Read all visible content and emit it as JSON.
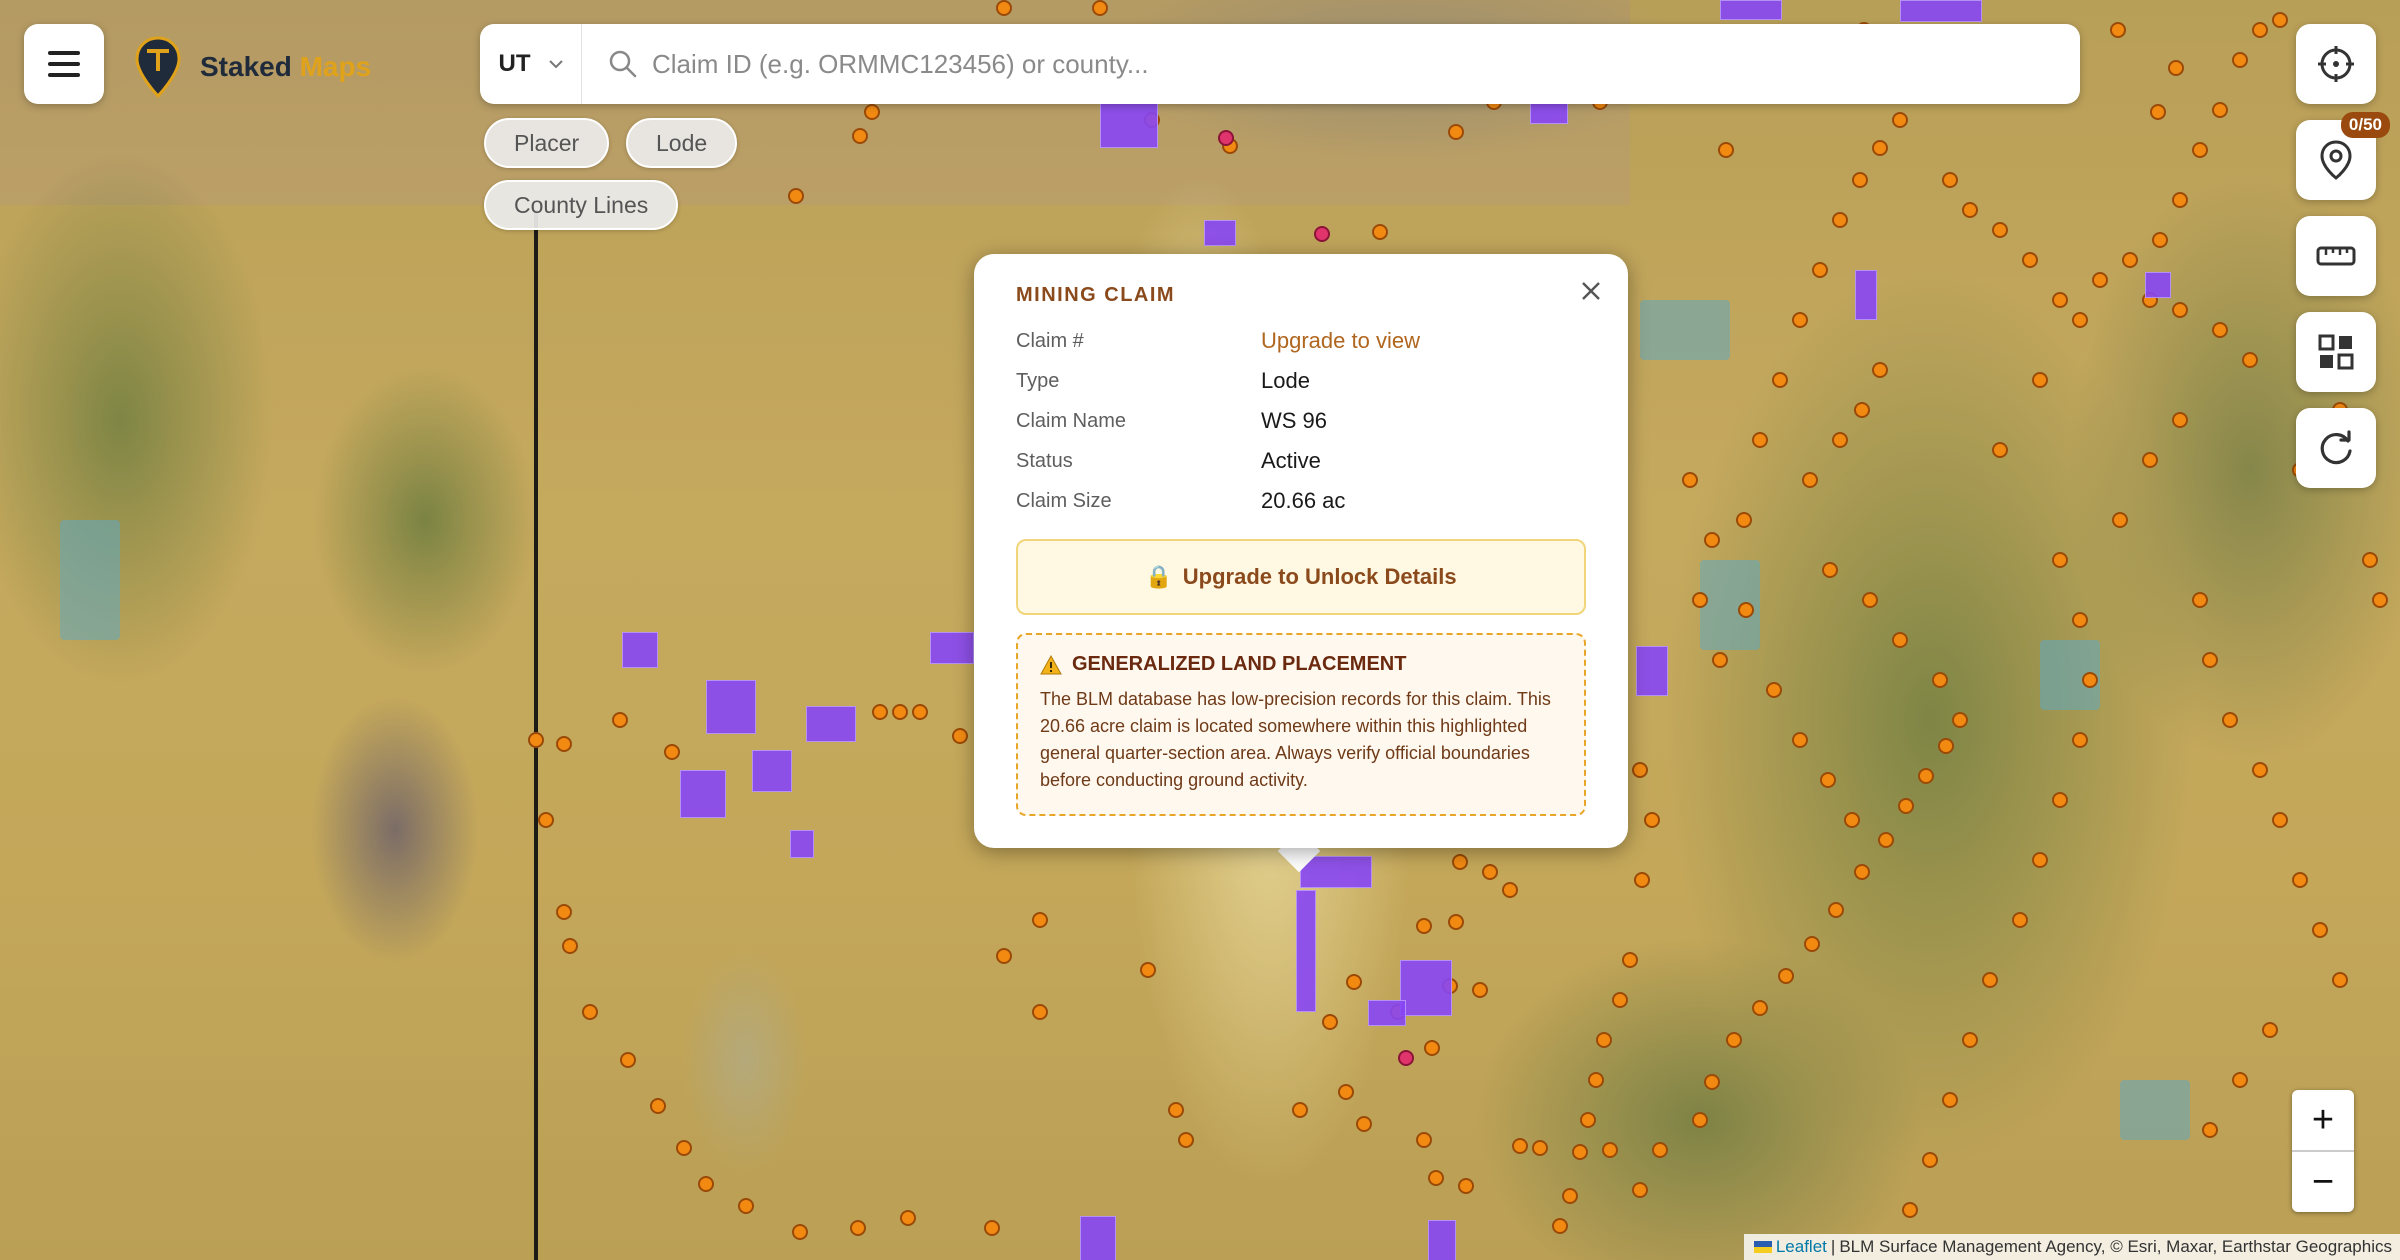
{
  "app": {
    "name_part1": "Staked",
    "name_part2": "Maps"
  },
  "search": {
    "state": "UT",
    "placeholder": "Claim ID (e.g. ORMMC123456) or county..."
  },
  "filters": [
    "Placer",
    "Lode",
    "County Lines"
  ],
  "controls": {
    "pin_count": "0/50"
  },
  "popup": {
    "title": "MINING CLAIM",
    "rows": [
      {
        "label": "Claim #",
        "value": "Upgrade to view"
      },
      {
        "label": "Type",
        "value": "Lode"
      },
      {
        "label": "Claim Name",
        "value": "WS 96"
      },
      {
        "label": "Status",
        "value": "Active"
      },
      {
        "label": "Claim Size",
        "value": "20.66 ac"
      }
    ],
    "unlock_label": "Upgrade to Unlock Details",
    "warning_title": "GENERALIZED LAND PLACEMENT",
    "warning_text": "The BLM database has low-precision records for this claim. This 20.66 acre claim is located somewhere within this highlighted general quarter-section area. Always verify official boundaries before conducting ground activity."
  },
  "zoom": {
    "in": "+",
    "out": "−"
  },
  "attribution": {
    "link": "Leaflet",
    "sep": "|",
    "text": "BLM Surface Management Agency, © Esri, Maxar, Earthstar Geographics"
  },
  "colors": {
    "placer": "#f28a12",
    "lode": "#8746f5",
    "accent": "#8b4a1c",
    "warning_border": "#e8a628"
  }
}
